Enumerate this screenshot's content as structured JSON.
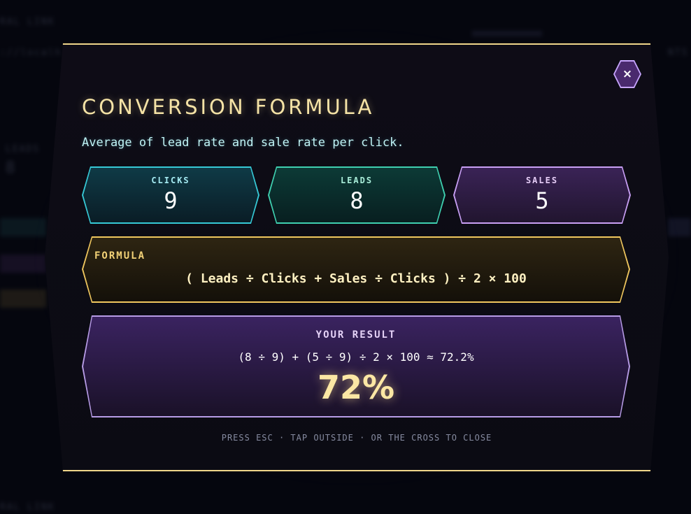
{
  "background": {
    "text_1": "RAL LINK",
    "text_2": "://localh",
    "text_3": "LEADS",
    "text_4": "8",
    "text_5": "NTS",
    "text_6": "RAL LINK"
  },
  "modal": {
    "title": "CONVERSION FORMULA",
    "subtitle": "Average of lead rate and sale rate per click.",
    "close_label": "×",
    "stats": {
      "clicks": {
        "label": "CLICKS",
        "value": "9"
      },
      "leads": {
        "label": "LEADS",
        "value": "8"
      },
      "sales": {
        "label": "SALES",
        "value": "5"
      }
    },
    "formula": {
      "label": "FORMULA",
      "expression": "( Leads ÷ Clicks + Sales ÷ Clicks ) ÷ 2 × 100"
    },
    "result": {
      "label": "YOUR RESULT",
      "calculation": "(8 ÷ 9) + (5 ÷ 9) ÷ 2 × 100 ≈ 72.2%",
      "value": "72%"
    },
    "hint": "PRESS ESC · TAP OUTSIDE · OR THE CROSS TO CLOSE"
  },
  "colors": {
    "accent_gold": "#f0d68a",
    "clicks_cyan": "#36c9d6",
    "leads_teal": "#3fd0b0",
    "sales_purple": "#c9a0f5",
    "result_text": "#fbe7a4"
  }
}
